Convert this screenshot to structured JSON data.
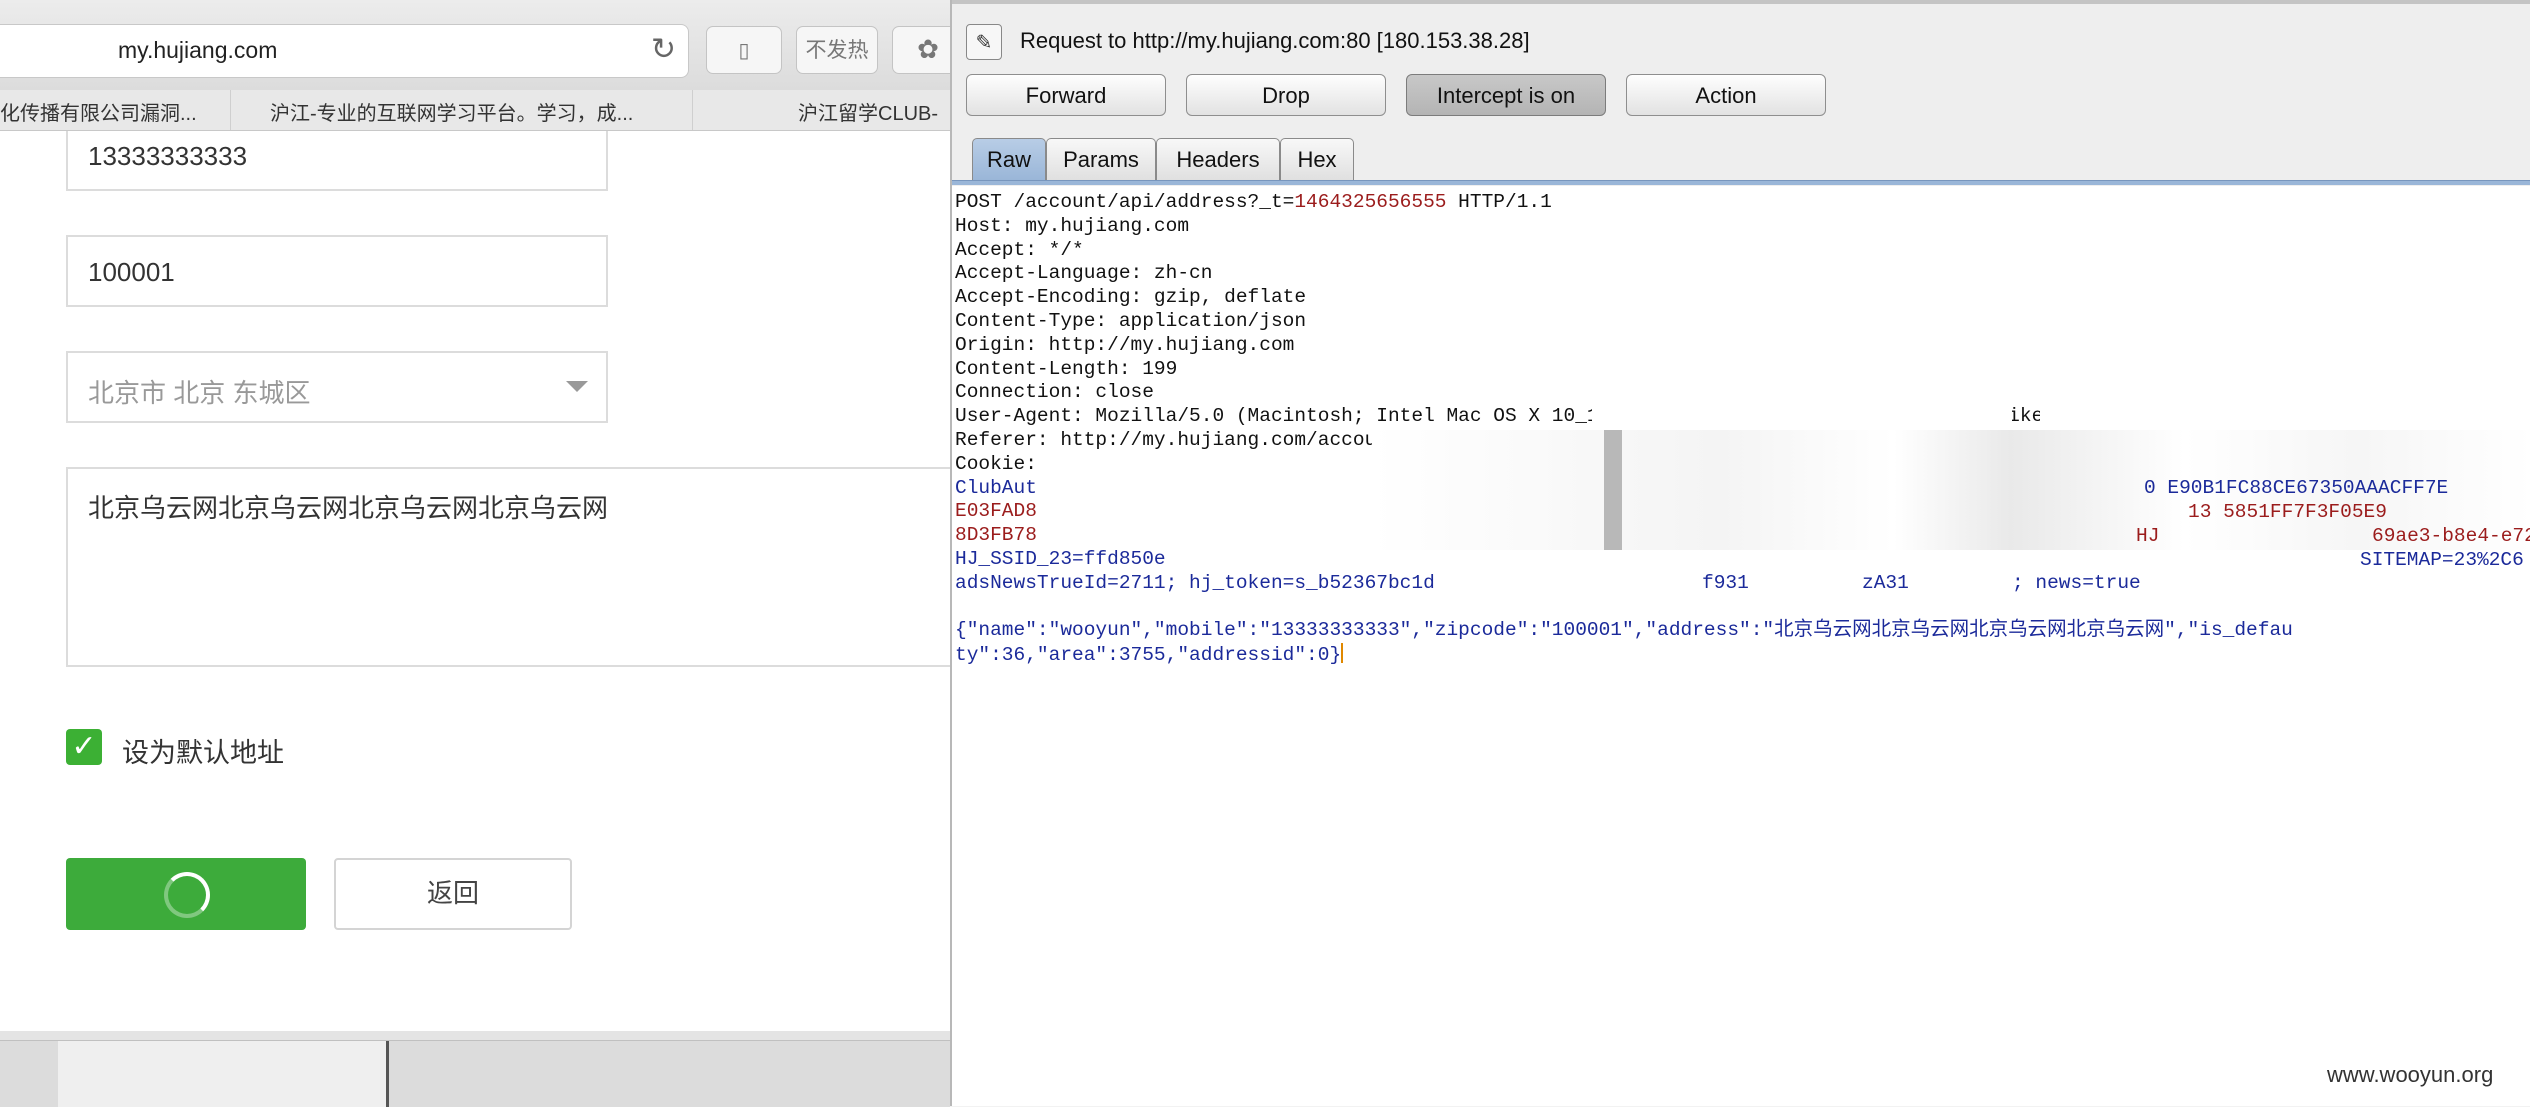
{
  "browser": {
    "url": "my.hujiang.com",
    "extension_label": "不发热",
    "bookmarks": [
      "化传播有限公司漏洞...",
      "沪江-专业的互联网学习平台。学习，成...",
      "沪江留学CLUB-"
    ]
  },
  "form": {
    "mobile": "13333333333",
    "zipcode": "100001",
    "region": "北京市 北京 东城区",
    "address": "北京乌云网北京乌云网北京乌云网北京乌云网",
    "default_label": "设为默认地址",
    "back_label": "返回"
  },
  "burp": {
    "title": "Request to http://my.hujiang.com:80  [180.153.38.28]",
    "buttons": {
      "forward": "Forward",
      "drop": "Drop",
      "intercept": "Intercept is on",
      "action": "Action"
    },
    "tabs": [
      "Raw",
      "Params",
      "Headers",
      "Hex"
    ],
    "request": {
      "line_prefix": "POST /account/api/address?_t=",
      "line_value": "1464325656555",
      "line_suffix": " HTTP/1.1",
      "headers": [
        "Host: my.hujiang.com",
        "Accept: */*",
        "Accept-Language: zh-cn",
        "Accept-Encoding: gzip, deflate",
        "Content-Type: application/json",
        "Origin: http://my.hujiang.com",
        "Content-Length: 199",
        "Connection: close",
        "User-Agent: Mozilla/5.0 (Macintosh; Intel Mac OS X 10_11_5) AppleWebKit/601.6.17 (KHTML, like Gecko) Version/9.1.",
        "Referer: http://my.hujiang.com/accou",
        "Cookie:"
      ],
      "cookie_lines": [
        "ClubAut",
        "E03FAD8",
        "8D3FB78",
        "HJ_SSID_23=ffd850e",
        "adsNewsTrueId=2711; hj_token=s_b52367bc1d"
      ],
      "cookie_fragments": {
        "line1_right": "0    E90B1FC88CE67350AAACFF7E",
        "line2_right": "13        5851FF7F3F05E9",
        "line3_mid": "HJ",
        "line3_right": "69ae3-b8e4-e72",
        "line4_right": "SITEMAP=23%2C6",
        "line5_mid": "f931",
        "line5_mid2": "zA31",
        "line5_right": "; news=true"
      },
      "body_line1": "{\"name\":\"wooyun\",\"mobile\":\"13333333333\",\"zipcode\":\"100001\",\"address\":\"北京乌云网北京乌云网北京乌云网北京乌云网\",\"is_defau",
      "body_line2": "ty\":36,\"area\":3755,\"addressid\":0}"
    }
  },
  "watermark": "www.wooyun.org",
  "colors": {
    "green_button": "#3dab3b",
    "burp_red": "#9b1c1c",
    "burp_blue": "#1b2a9a",
    "tab_active": "#9ab6d8"
  }
}
